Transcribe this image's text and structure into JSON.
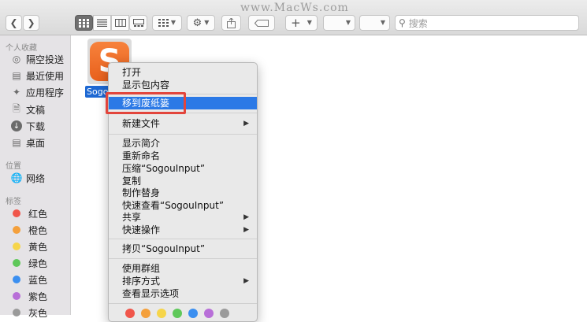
{
  "toolbar": {
    "back_icon": "chevron-left-icon",
    "forward_icon": "chevron-right-icon",
    "view_modes": [
      "icon-view-icon",
      "list-view-icon",
      "column-view-icon",
      "gallery-view-icon"
    ],
    "group_icon": "group-grid-icon",
    "action_icon": "gear-icon",
    "share_icon": "share-icon",
    "tag_icon": "tag-icon",
    "add_label": "+",
    "watermark": "www.MacWs.com",
    "search_placeholder": "搜索"
  },
  "sidebar": {
    "favorites_title": "个人收藏",
    "favorites": [
      {
        "label": "隔空投送",
        "icon": "airdrop-icon"
      },
      {
        "label": "最近使用",
        "icon": "recents-icon"
      },
      {
        "label": "应用程序",
        "icon": "applications-icon"
      },
      {
        "label": "文稿",
        "icon": "documents-icon"
      },
      {
        "label": "下载",
        "icon": "downloads-icon"
      },
      {
        "label": "桌面",
        "icon": "desktop-icon"
      }
    ],
    "locations_title": "位置",
    "locations": [
      {
        "label": "网络",
        "icon": "network-icon"
      }
    ],
    "tags_title": "标签",
    "tags": [
      {
        "label": "红色",
        "color": "#f0564b"
      },
      {
        "label": "橙色",
        "color": "#f4a03c"
      },
      {
        "label": "黄色",
        "color": "#f6d54a"
      },
      {
        "label": "绿色",
        "color": "#5fc85a"
      },
      {
        "label": "蓝色",
        "color": "#3b8ff0"
      },
      {
        "label": "紫色",
        "color": "#b86fd8"
      },
      {
        "label": "灰色",
        "color": "#9a9a9a"
      }
    ]
  },
  "file": {
    "name": "SogouInput",
    "label_visible": "Sogo"
  },
  "menu": {
    "items": [
      {
        "label": "打开"
      },
      {
        "label": "显示包内容"
      },
      {
        "label": "移到废纸篓",
        "highlighted": true
      },
      {
        "label": "新建文件",
        "submenu": true
      },
      {
        "label": "显示简介"
      },
      {
        "label": "重新命名"
      },
      {
        "label": "压缩“SogouInput”"
      },
      {
        "label": "复制"
      },
      {
        "label": "制作替身"
      },
      {
        "label": "快速查看“SogouInput”"
      },
      {
        "label": "共享",
        "submenu": true
      },
      {
        "label": "快速操作",
        "submenu": true
      },
      {
        "label": "拷贝“SogouInput”"
      },
      {
        "label": "使用群组"
      },
      {
        "label": "排序方式",
        "submenu": true
      },
      {
        "label": "查看显示选项"
      }
    ],
    "tag_colors": [
      "#f0564b",
      "#f4a03c",
      "#f6d54a",
      "#5fc85a",
      "#3b8ff0",
      "#b86fd8",
      "#9a9a9a"
    ],
    "highlight_color": "#2b79e6",
    "annotation_color": "#e2453c"
  }
}
